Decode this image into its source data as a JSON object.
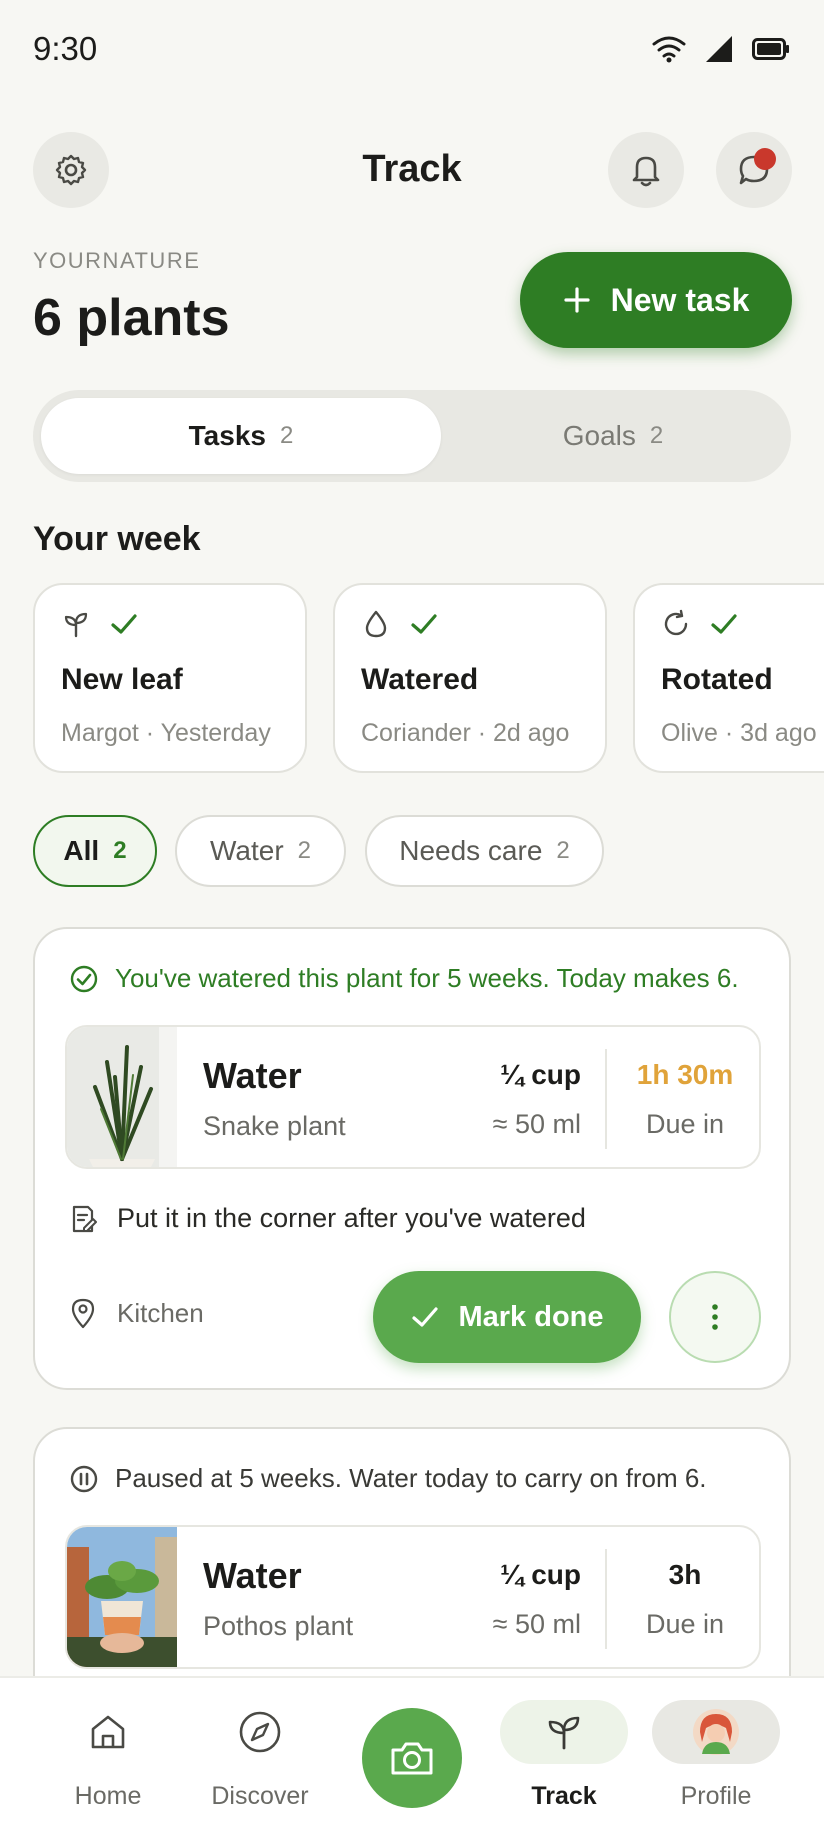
{
  "status_bar": {
    "time": "9:30"
  },
  "header": {
    "title": "Track"
  },
  "summary": {
    "overline": "YOURNATURE",
    "plant_count": "6 plants",
    "new_task_label": "New task"
  },
  "segments": [
    {
      "label": "Tasks",
      "count": "2"
    },
    {
      "label": "Goals",
      "count": "2"
    }
  ],
  "week": {
    "heading": "Your week",
    "cards": [
      {
        "icon": "sprout-icon",
        "title": "New leaf",
        "subtitle": "Margot · Yesterday"
      },
      {
        "icon": "water-drop-icon",
        "title": "Watered",
        "subtitle": "Coriander · 2d ago"
      },
      {
        "icon": "rotate-icon",
        "title": "Rotated",
        "subtitle": "Olive · 3d ago"
      }
    ]
  },
  "filters": [
    {
      "label": "All",
      "count": "2"
    },
    {
      "label": "Water",
      "count": "2"
    },
    {
      "label": "Needs care",
      "count": "2"
    }
  ],
  "tasks": [
    {
      "note": "You've watered this plant for 5 weeks. Today makes 6.",
      "title": "Water",
      "plant": "Snake plant",
      "amount": "¼ cup",
      "amount_ml": "≈ 50 ml",
      "due_value": "1h 30m",
      "due_label": "Due in",
      "instruction": "Put it in the corner after you've watered",
      "location": "Kitchen",
      "mark_done_label": "Mark done"
    },
    {
      "note": "Paused at 5 weeks. Water today to carry on from 6.",
      "title": "Water",
      "plant": "Pothos plant",
      "amount": "¼ cup",
      "amount_ml": "≈ 50 ml",
      "due_value": "3h",
      "due_label": "Due in"
    }
  ],
  "nav": [
    {
      "label": "Home",
      "icon": "home-icon"
    },
    {
      "label": "Discover",
      "icon": "compass-icon"
    },
    {
      "label": "",
      "icon": "camera-icon"
    },
    {
      "label": "Track",
      "icon": "sprout-icon"
    },
    {
      "label": "Profile",
      "icon": "avatar"
    }
  ],
  "colors": {
    "brand_green": "#2e7d24",
    "action_green": "#5aa94d",
    "due_orange": "#e0a33a",
    "notification_red": "#c9382c",
    "background": "#f7f7f3"
  }
}
